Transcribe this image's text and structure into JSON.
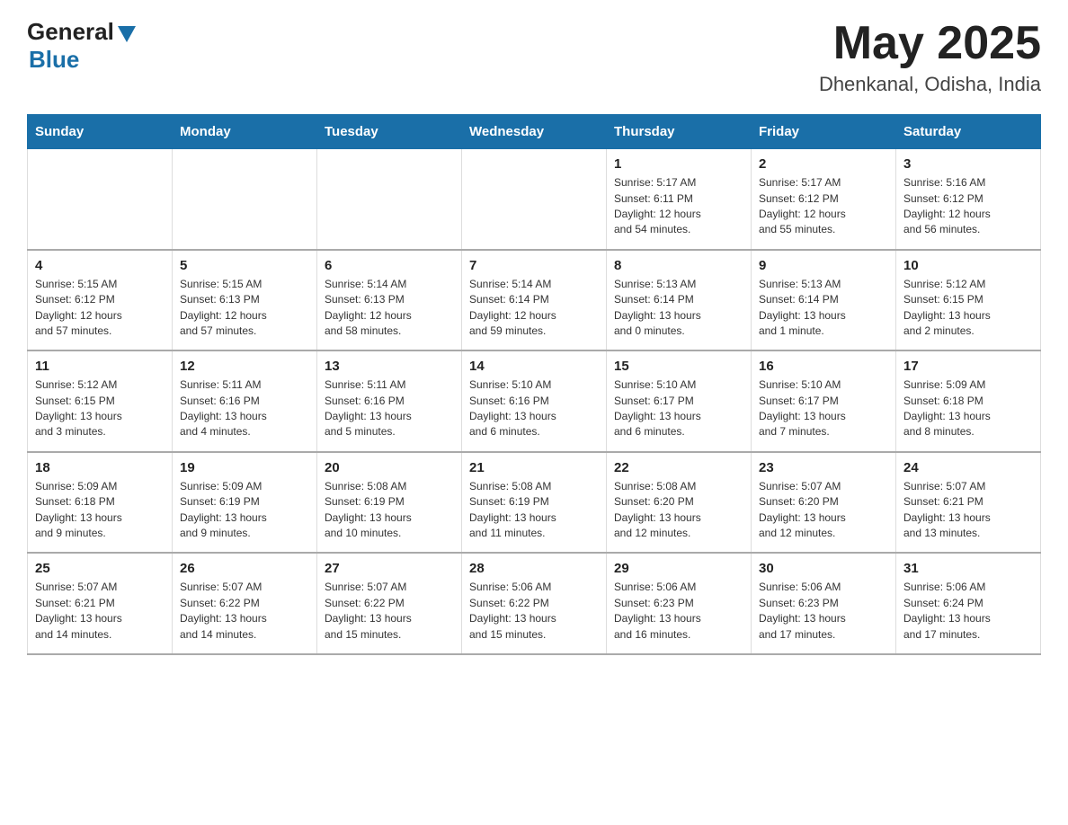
{
  "logo": {
    "general": "General",
    "blue": "Blue"
  },
  "header": {
    "month_year": "May 2025",
    "location": "Dhenkanal, Odisha, India"
  },
  "days_of_week": [
    "Sunday",
    "Monday",
    "Tuesday",
    "Wednesday",
    "Thursday",
    "Friday",
    "Saturday"
  ],
  "weeks": [
    [
      {
        "day": "",
        "info": ""
      },
      {
        "day": "",
        "info": ""
      },
      {
        "day": "",
        "info": ""
      },
      {
        "day": "",
        "info": ""
      },
      {
        "day": "1",
        "info": "Sunrise: 5:17 AM\nSunset: 6:11 PM\nDaylight: 12 hours\nand 54 minutes."
      },
      {
        "day": "2",
        "info": "Sunrise: 5:17 AM\nSunset: 6:12 PM\nDaylight: 12 hours\nand 55 minutes."
      },
      {
        "day": "3",
        "info": "Sunrise: 5:16 AM\nSunset: 6:12 PM\nDaylight: 12 hours\nand 56 minutes."
      }
    ],
    [
      {
        "day": "4",
        "info": "Sunrise: 5:15 AM\nSunset: 6:12 PM\nDaylight: 12 hours\nand 57 minutes."
      },
      {
        "day": "5",
        "info": "Sunrise: 5:15 AM\nSunset: 6:13 PM\nDaylight: 12 hours\nand 57 minutes."
      },
      {
        "day": "6",
        "info": "Sunrise: 5:14 AM\nSunset: 6:13 PM\nDaylight: 12 hours\nand 58 minutes."
      },
      {
        "day": "7",
        "info": "Sunrise: 5:14 AM\nSunset: 6:14 PM\nDaylight: 12 hours\nand 59 minutes."
      },
      {
        "day": "8",
        "info": "Sunrise: 5:13 AM\nSunset: 6:14 PM\nDaylight: 13 hours\nand 0 minutes."
      },
      {
        "day": "9",
        "info": "Sunrise: 5:13 AM\nSunset: 6:14 PM\nDaylight: 13 hours\nand 1 minute."
      },
      {
        "day": "10",
        "info": "Sunrise: 5:12 AM\nSunset: 6:15 PM\nDaylight: 13 hours\nand 2 minutes."
      }
    ],
    [
      {
        "day": "11",
        "info": "Sunrise: 5:12 AM\nSunset: 6:15 PM\nDaylight: 13 hours\nand 3 minutes."
      },
      {
        "day": "12",
        "info": "Sunrise: 5:11 AM\nSunset: 6:16 PM\nDaylight: 13 hours\nand 4 minutes."
      },
      {
        "day": "13",
        "info": "Sunrise: 5:11 AM\nSunset: 6:16 PM\nDaylight: 13 hours\nand 5 minutes."
      },
      {
        "day": "14",
        "info": "Sunrise: 5:10 AM\nSunset: 6:16 PM\nDaylight: 13 hours\nand 6 minutes."
      },
      {
        "day": "15",
        "info": "Sunrise: 5:10 AM\nSunset: 6:17 PM\nDaylight: 13 hours\nand 6 minutes."
      },
      {
        "day": "16",
        "info": "Sunrise: 5:10 AM\nSunset: 6:17 PM\nDaylight: 13 hours\nand 7 minutes."
      },
      {
        "day": "17",
        "info": "Sunrise: 5:09 AM\nSunset: 6:18 PM\nDaylight: 13 hours\nand 8 minutes."
      }
    ],
    [
      {
        "day": "18",
        "info": "Sunrise: 5:09 AM\nSunset: 6:18 PM\nDaylight: 13 hours\nand 9 minutes."
      },
      {
        "day": "19",
        "info": "Sunrise: 5:09 AM\nSunset: 6:19 PM\nDaylight: 13 hours\nand 9 minutes."
      },
      {
        "day": "20",
        "info": "Sunrise: 5:08 AM\nSunset: 6:19 PM\nDaylight: 13 hours\nand 10 minutes."
      },
      {
        "day": "21",
        "info": "Sunrise: 5:08 AM\nSunset: 6:19 PM\nDaylight: 13 hours\nand 11 minutes."
      },
      {
        "day": "22",
        "info": "Sunrise: 5:08 AM\nSunset: 6:20 PM\nDaylight: 13 hours\nand 12 minutes."
      },
      {
        "day": "23",
        "info": "Sunrise: 5:07 AM\nSunset: 6:20 PM\nDaylight: 13 hours\nand 12 minutes."
      },
      {
        "day": "24",
        "info": "Sunrise: 5:07 AM\nSunset: 6:21 PM\nDaylight: 13 hours\nand 13 minutes."
      }
    ],
    [
      {
        "day": "25",
        "info": "Sunrise: 5:07 AM\nSunset: 6:21 PM\nDaylight: 13 hours\nand 14 minutes."
      },
      {
        "day": "26",
        "info": "Sunrise: 5:07 AM\nSunset: 6:22 PM\nDaylight: 13 hours\nand 14 minutes."
      },
      {
        "day": "27",
        "info": "Sunrise: 5:07 AM\nSunset: 6:22 PM\nDaylight: 13 hours\nand 15 minutes."
      },
      {
        "day": "28",
        "info": "Sunrise: 5:06 AM\nSunset: 6:22 PM\nDaylight: 13 hours\nand 15 minutes."
      },
      {
        "day": "29",
        "info": "Sunrise: 5:06 AM\nSunset: 6:23 PM\nDaylight: 13 hours\nand 16 minutes."
      },
      {
        "day": "30",
        "info": "Sunrise: 5:06 AM\nSunset: 6:23 PM\nDaylight: 13 hours\nand 17 minutes."
      },
      {
        "day": "31",
        "info": "Sunrise: 5:06 AM\nSunset: 6:24 PM\nDaylight: 13 hours\nand 17 minutes."
      }
    ]
  ]
}
